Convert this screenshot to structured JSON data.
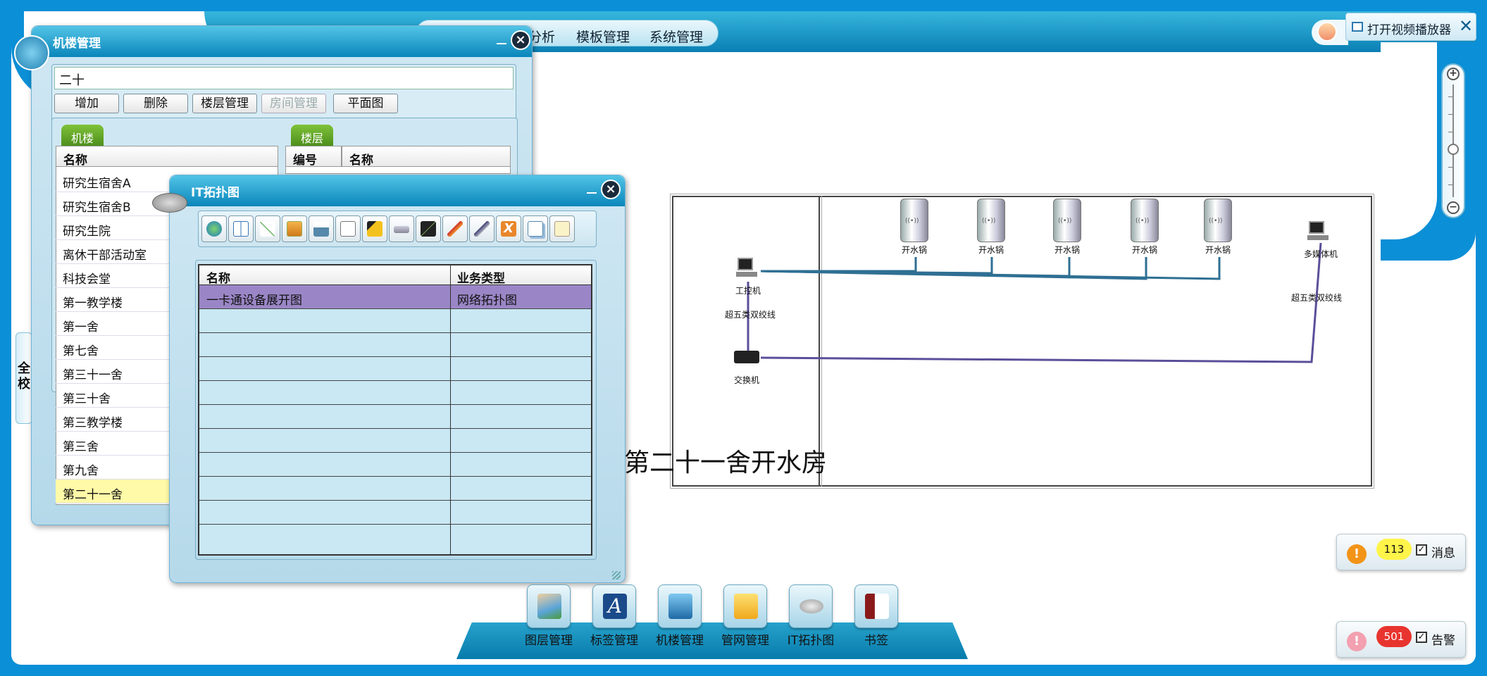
{
  "nav": {
    "items": [
      "分析",
      "模板管理",
      "系统管理"
    ]
  },
  "video_button": {
    "label": "打开视频播放器",
    "close": "✕"
  },
  "side_tab": {
    "label": "全校"
  },
  "building_window": {
    "title": "机楼管理",
    "search_value": "二十",
    "buttons": [
      "增加",
      "删除",
      "楼层管理",
      "房间管理",
      "平面图"
    ],
    "left_tab": "机楼",
    "right_tab": "楼层",
    "left_header": "名称",
    "right_headers": [
      "编号",
      "名称"
    ],
    "buildings": [
      "研究生宿舍A",
      "研究生宿舍B",
      "研究生院",
      "离休干部活动室",
      "科技会堂",
      "第一教学楼",
      "第一舍",
      "第七舍",
      "第三十一舍",
      "第三十舍",
      "第三教学楼",
      "第三舍",
      "第九舍",
      "第二十一舍"
    ],
    "selected_building": "第二十一舍"
  },
  "it_window": {
    "title": "IT拓扑图",
    "headers": [
      "名称",
      "业务类型"
    ],
    "rows": [
      {
        "name": "一卡通设备展开图",
        "type": "网络拓扑图"
      }
    ],
    "tools": [
      "globe-icon",
      "book-icon",
      "network-icon",
      "windows-icon",
      "basket-icon",
      "document-icon",
      "yellow-shape-icon",
      "switch-icon",
      "line-chart-icon",
      "pen-icon",
      "draw-icon",
      "delete-icon",
      "copy-icon",
      "paste-icon"
    ]
  },
  "topology": {
    "room_title": "第二十一舍开水房",
    "boiler_label": "开水锅",
    "workstation": "工控机",
    "cable_left": "超五类双绞线",
    "switch": "交换机",
    "multimedia": "多媒体机",
    "cable_right": "超五类双绞线",
    "colors": {
      "link_a": "#2f6f93",
      "link_b": "#5a4f9a"
    }
  },
  "dock": {
    "items": [
      "图层管理",
      "标签管理",
      "机楼管理",
      "管网管理",
      "IT拓扑图",
      "书签"
    ]
  },
  "alerts": {
    "messages": {
      "count": "113",
      "label": "消息",
      "color": "#fff44a"
    },
    "alarms": {
      "count": "501",
      "label": "告警",
      "color": "#e8342f"
    }
  }
}
